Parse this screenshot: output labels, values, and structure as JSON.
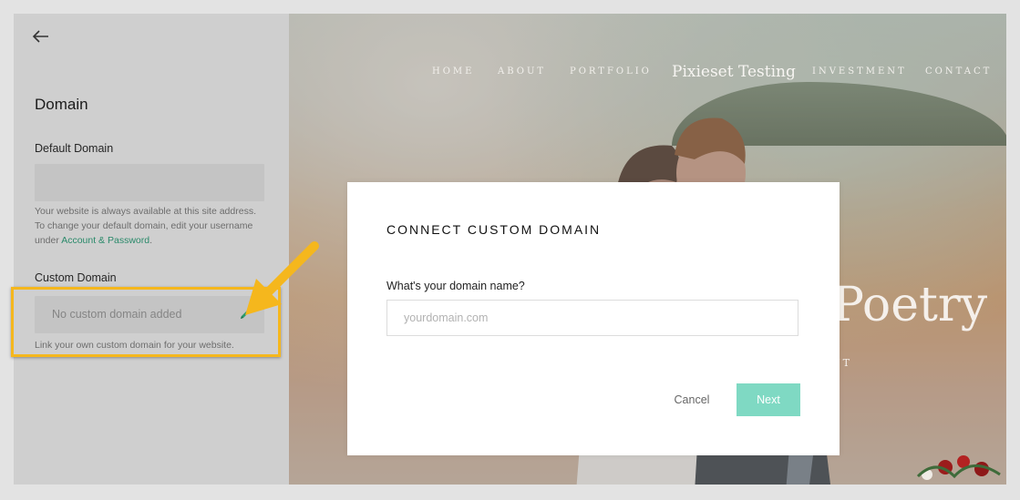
{
  "sidebar": {
    "title": "Domain",
    "default_domain_label": "Default Domain",
    "default_help_line1": "Your website is always available at this site address.",
    "default_help_line2": "To change your default domain, edit your username",
    "default_help_prefix": "under",
    "default_help_link": "Account & Password",
    "default_help_suffix": ".",
    "custom_domain_label": "Custom Domain",
    "custom_domain_empty": "No custom domain added",
    "custom_domain_help": "Link your own custom domain for your website."
  },
  "website": {
    "nav": [
      "HOME",
      "ABOUT",
      "PORTFOLIO",
      "INVESTMENT",
      "CONTACT"
    ],
    "logo": "Pixieset Testing",
    "hero_title_visible": "Poetry",
    "hero_sub_visible": "NT"
  },
  "modal": {
    "title": "CONNECT CUSTOM DOMAIN",
    "field_label": "What's your domain name?",
    "input_value": "",
    "input_placeholder": "yourdomain.com",
    "cancel_label": "Cancel",
    "next_label": "Next"
  },
  "colors": {
    "accent": "#7fd9c3",
    "link": "#2a8a6a",
    "annotation": "#f5b71d"
  },
  "icons": {
    "back": "arrow-left-icon",
    "edit": "pencil-icon",
    "annotation": "arrow-annotation-icon"
  }
}
